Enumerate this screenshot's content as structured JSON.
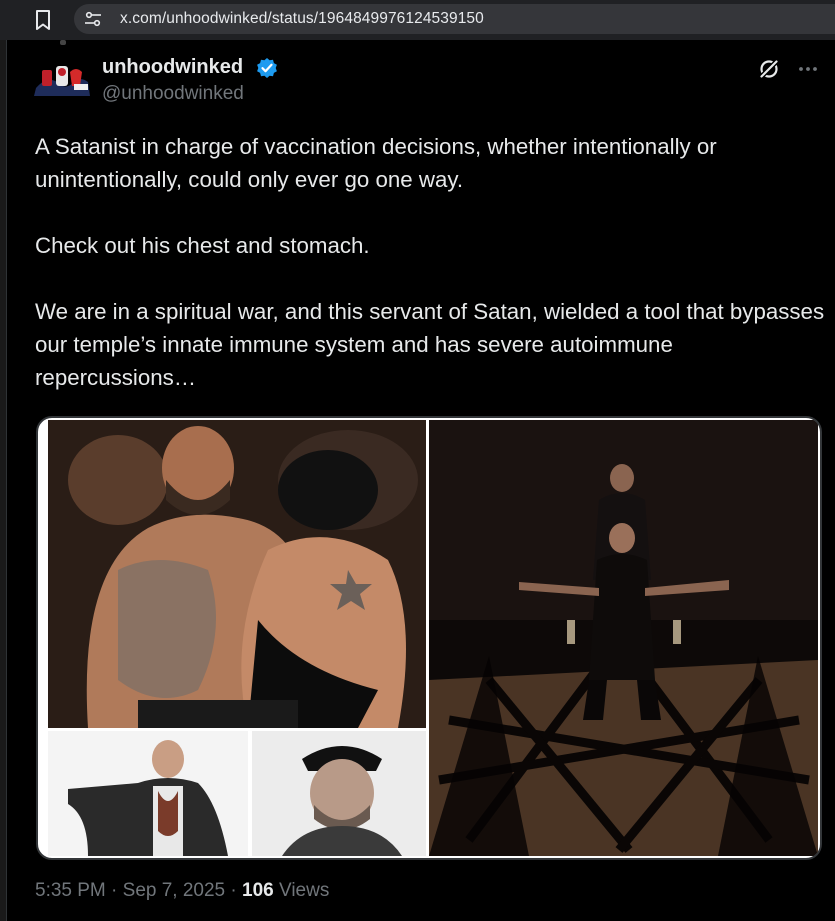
{
  "browser": {
    "url": "x.com/unhoodwinked/status/1964849976124539150"
  },
  "tweet": {
    "author": {
      "name": "unhoodwinked",
      "handle": "@unhoodwinked",
      "verified": true
    },
    "text": "A Satanist in charge of vaccination decisions, whether intentionally or unintentionally, could only ever go one way.\n\nCheck out his chest and stomach.\n\nWe are in a spiritual war, and this servant of Satan, wielded a tool that bypasses our temple’s innate immune system and has severe autoimmune repercussions…",
    "media": {
      "count": 4
    },
    "timestamp": "5:35 PM · Sep 7, 2025 · ",
    "views_count": "106",
    "views_label": " Views"
  },
  "colors": {
    "accent": "#1d9bf0",
    "text_primary": "#e7e9ea",
    "text_secondary": "#71767b",
    "background": "#000000",
    "border": "#333639"
  },
  "icons": [
    "bookmark-icon",
    "site-info-icon",
    "verified-icon",
    "grok-icon",
    "more-icon"
  ]
}
